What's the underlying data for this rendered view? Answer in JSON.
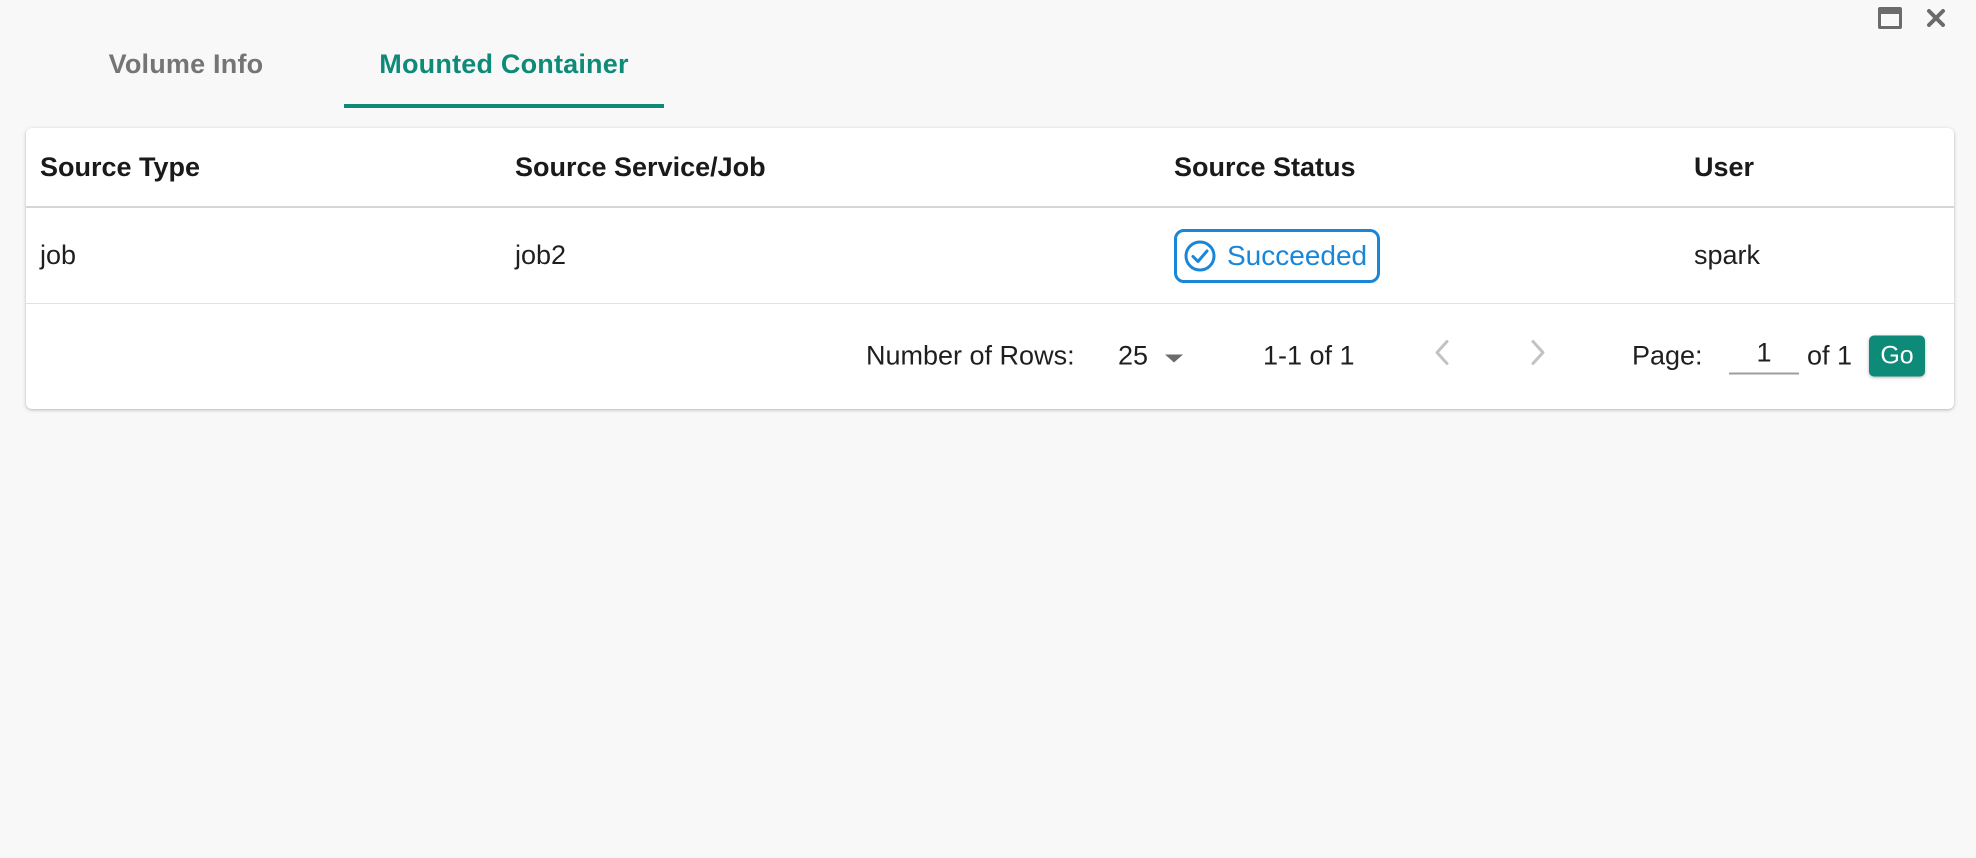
{
  "window_controls": {
    "minimize_icon": "window-minimize-icon",
    "close_icon": "close-icon"
  },
  "tabs": [
    {
      "label": "Volume Info",
      "active": false
    },
    {
      "label": "Mounted Container",
      "active": true
    }
  ],
  "table": {
    "columns": [
      "Source Type",
      "Source Service/Job",
      "Source Status",
      "User"
    ],
    "rows": [
      {
        "source_type": "job",
        "source_service": "job2",
        "source_status": "Succeeded",
        "user": "spark"
      }
    ]
  },
  "pagination": {
    "rows_label": "Number of Rows:",
    "rows_value": "25",
    "range_text": "1-1 of 1",
    "page_label": "Page:",
    "page_value": "1",
    "of_total": "of 1",
    "go_label": "Go"
  },
  "colors": {
    "accent": "#0e8a78",
    "status_succeeded": "#1a86d8",
    "background": "#f8f8f8"
  }
}
